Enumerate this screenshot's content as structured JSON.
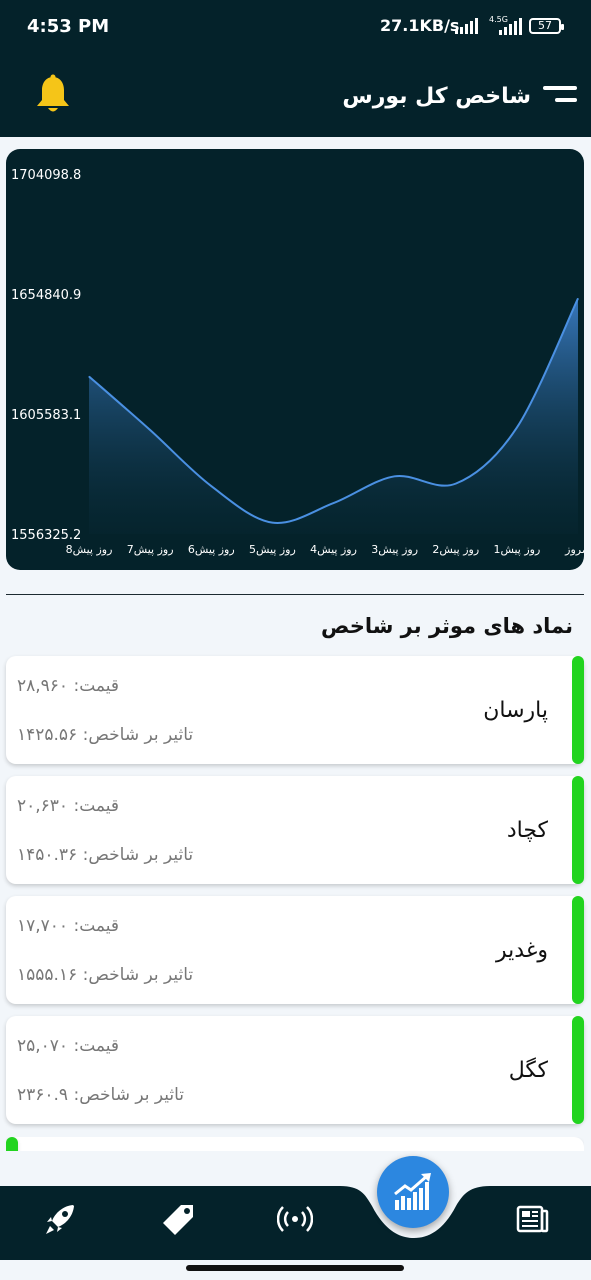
{
  "status_bar": {
    "time": "4:53 PM",
    "speed": "27.1KB/s",
    "network": "4.5G",
    "battery": "57"
  },
  "header": {
    "title": "شاخص کل بورس",
    "bell_icon": "bell-icon",
    "menu_icon": "menu-icon"
  },
  "chart_data": {
    "type": "area",
    "categories": [
      "8روز پیش",
      "7روز پیش",
      "6روز پیش",
      "5روز پیش",
      "4روز پیش",
      "3روز پیش",
      "2روز پیش",
      "1روز پیش",
      "امروز"
    ],
    "x_tick_labels": [
      "8روز پیش",
      "7روز پیش",
      "6روز پیش",
      "5روز پیش",
      "4روز پیش",
      "3روز پیش",
      "2روز پیش",
      "1روز پیش",
      "امروز"
    ],
    "values": [
      1621000,
      1599000,
      1576000,
      1561000,
      1569000,
      1580000,
      1577000,
      1600000,
      1653000
    ],
    "y_tick_labels": [
      "1704098.8",
      "1654840.9",
      "1605583.1",
      "1556325.2"
    ],
    "y_ticks": [
      1704098.8,
      1654840.9,
      1605583.1,
      1556325.2
    ],
    "ylim": [
      1556325.2,
      1704098.8
    ],
    "grid": false,
    "line_color": "#4a90e2"
  },
  "section": {
    "title": "نماد های موثر بر شاخص"
  },
  "items": [
    {
      "symbol": "پارسان",
      "price": "۲۸,۹۶۰ :قیمت",
      "impact": "۱۴۲۵.۵۶ :تاثیر بر شاخص"
    },
    {
      "symbol": "کچاد",
      "price": "۲۰,۶۳۰ :قیمت",
      "impact": "۱۴۵۰.۳۶ :تاثیر بر شاخص"
    },
    {
      "symbol": "وغدیر",
      "price": "۱۷,۷۰۰ :قیمت",
      "impact": "۱۵۵۵.۱۶ :تاثیر بر شاخص"
    },
    {
      "symbol": "کگل",
      "price": "۲۵,۰۷۰ :قیمت",
      "impact": "۲۳۶۰.۹ :تاثیر بر شاخص"
    }
  ],
  "colors": {
    "header_bg": "#04222a",
    "accent": "#2c87e0",
    "positive": "#22d41f",
    "bell": "#f5c518"
  },
  "nav": {
    "items": [
      {
        "icon": "rocket-icon"
      },
      {
        "icon": "tag-icon"
      },
      {
        "icon": "broadcast-icon"
      },
      {
        "icon": "trend-chart-icon",
        "active": true
      },
      {
        "icon": "newspaper-icon"
      }
    ]
  }
}
